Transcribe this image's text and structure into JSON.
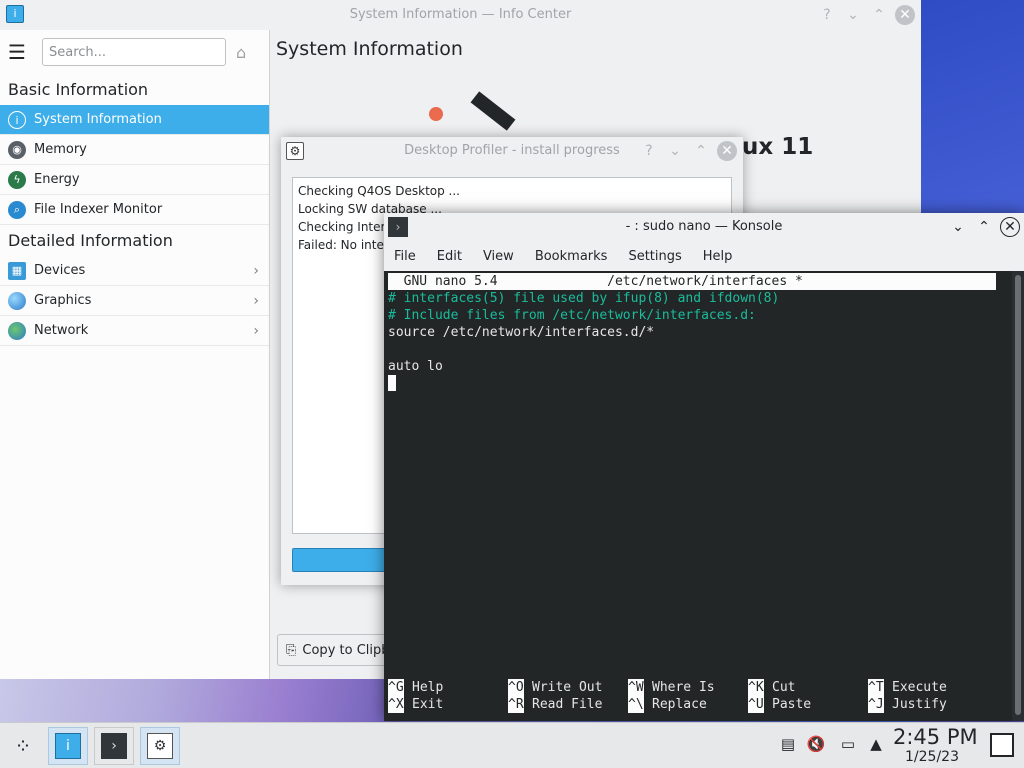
{
  "info_center": {
    "title": "System Information — Info Center",
    "search_placeholder": "Search...",
    "heading_basic": "Basic Information",
    "heading_detailed": "Detailed Information",
    "basic_items": [
      "System Information",
      "Memory",
      "Energy",
      "File Indexer Monitor"
    ],
    "detailed_items": [
      "Devices",
      "Graphics",
      "Network"
    ],
    "page_title": "System Information",
    "distro_text": "ux 11",
    "copy_button": "Copy to Clipb"
  },
  "profiler": {
    "title": "Desktop Profiler - install progress",
    "log": [
      "Checking Q4OS Desktop ...",
      "Locking SW database ...",
      "Checking Intern",
      "Failed: No intern"
    ]
  },
  "konsole": {
    "title": "- : sudo nano — Konsole",
    "menu": [
      "File",
      "Edit",
      "View",
      "Bookmarks",
      "Settings",
      "Help"
    ],
    "nano_header": "  GNU nano 5.4              /etc/network/interfaces *",
    "lines": [
      "# interfaces(5) file used by ifup(8) and ifdown(8)",
      "# Include files from /etc/network/interfaces.d:",
      "source /etc/network/interfaces.d/*",
      "",
      "auto lo"
    ],
    "shortcuts_row1": [
      {
        "key": "^G",
        "label": "Help"
      },
      {
        "key": "^O",
        "label": "Write Out"
      },
      {
        "key": "^W",
        "label": "Where Is"
      },
      {
        "key": "^K",
        "label": "Cut"
      },
      {
        "key": "^T",
        "label": "Execute"
      }
    ],
    "shortcuts_row2": [
      {
        "key": "^X",
        "label": "Exit"
      },
      {
        "key": "^R",
        "label": "Read File"
      },
      {
        "key": "^\\",
        "label": "Replace"
      },
      {
        "key": "^U",
        "label": "Paste"
      },
      {
        "key": "^J",
        "label": "Justify"
      }
    ]
  },
  "taskbar": {
    "time": "2:45 PM",
    "date": "1/25/23"
  },
  "colors": {
    "accent": "#3daee9",
    "terminal_bg": "#232627",
    "comment": "#1abc9c"
  }
}
